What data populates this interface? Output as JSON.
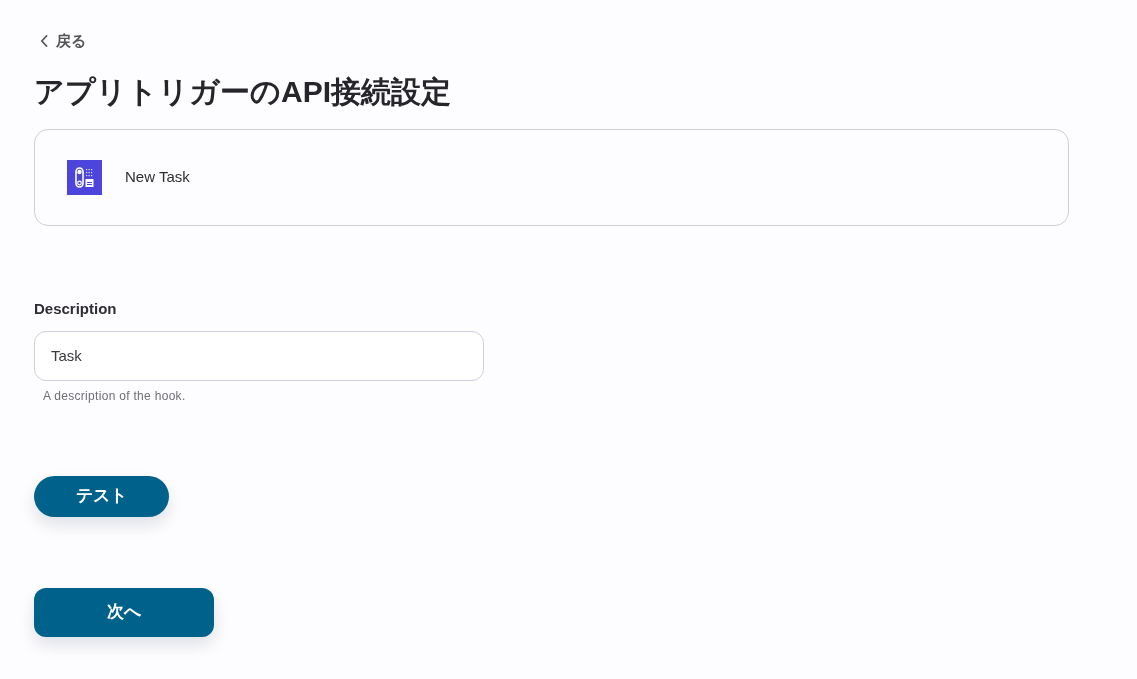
{
  "back_link": {
    "label": "戻る"
  },
  "title": "アプリトリガーのAPI接続設定",
  "trigger": {
    "label": "New Task"
  },
  "fields": [
    {
      "label": "Description",
      "value": "Task",
      "help": "A description of the hook."
    }
  ],
  "test_button": {
    "label": "テスト"
  },
  "next_button": {
    "label": "次へ"
  }
}
